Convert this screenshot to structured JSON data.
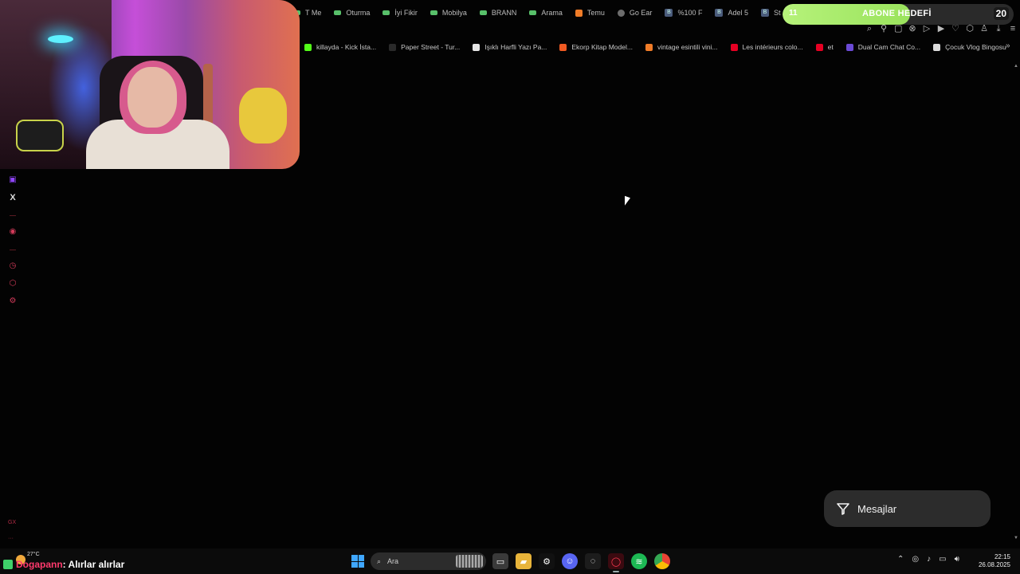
{
  "tabs": [
    {
      "label": "T Me",
      "icon": "green-tab-icon"
    },
    {
      "label": "Oturma",
      "icon": "green-tab-icon"
    },
    {
      "label": "İyi Fikir",
      "icon": "green-tab-icon"
    },
    {
      "label": "Mobilya",
      "icon": "green-tab-icon"
    },
    {
      "label": "BRANN",
      "icon": "green-tab-icon"
    },
    {
      "label": "Arama",
      "icon": "green-tab-icon"
    },
    {
      "label": "Temu",
      "icon": "temu-icon"
    },
    {
      "label": "Go Ear",
      "icon": "globe-icon"
    },
    {
      "label": "%100 F",
      "icon": "b-icon"
    },
    {
      "label": "Adel 5",
      "icon": "b-icon"
    },
    {
      "label": "Steve R",
      "icon": "b-icon"
    }
  ],
  "goal": {
    "current": "11",
    "title": "ABONE HEDEFİ",
    "target": "20",
    "progress": 0.55
  },
  "bookmarks": [
    {
      "label": "killayda - Kick İsta...",
      "color": "#53fc18"
    },
    {
      "label": "Paper Street - Tur...",
      "color": "#2a2a2a"
    },
    {
      "label": "Işıklı Harfli Yazı Pa...",
      "color": "#e6e6e6"
    },
    {
      "label": "Ekorp Kitap Model...",
      "color": "#f05a22"
    },
    {
      "label": "vintage esintili vini...",
      "color": "#f07c28"
    },
    {
      "label": "Les intérieurs colo...",
      "color": "#e60023"
    },
    {
      "label": "et",
      "color": "#e60023"
    },
    {
      "label": "Dual Cam Chat Co...",
      "color": "#6b4ad6"
    },
    {
      "label": "Çocuk Vlog Bingosu",
      "color": "#dcdcdc"
    }
  ],
  "sidebar": {
    "foot_label": "GX"
  },
  "messages": {
    "label": "Mesajlar"
  },
  "taskbar": {
    "temperature": "27°C",
    "ticker_name": "Dogapann",
    "ticker_text": ": Alırlar alırlar",
    "search_placeholder": "Ara",
    "time": "22:15",
    "date": "26.08.2025"
  }
}
